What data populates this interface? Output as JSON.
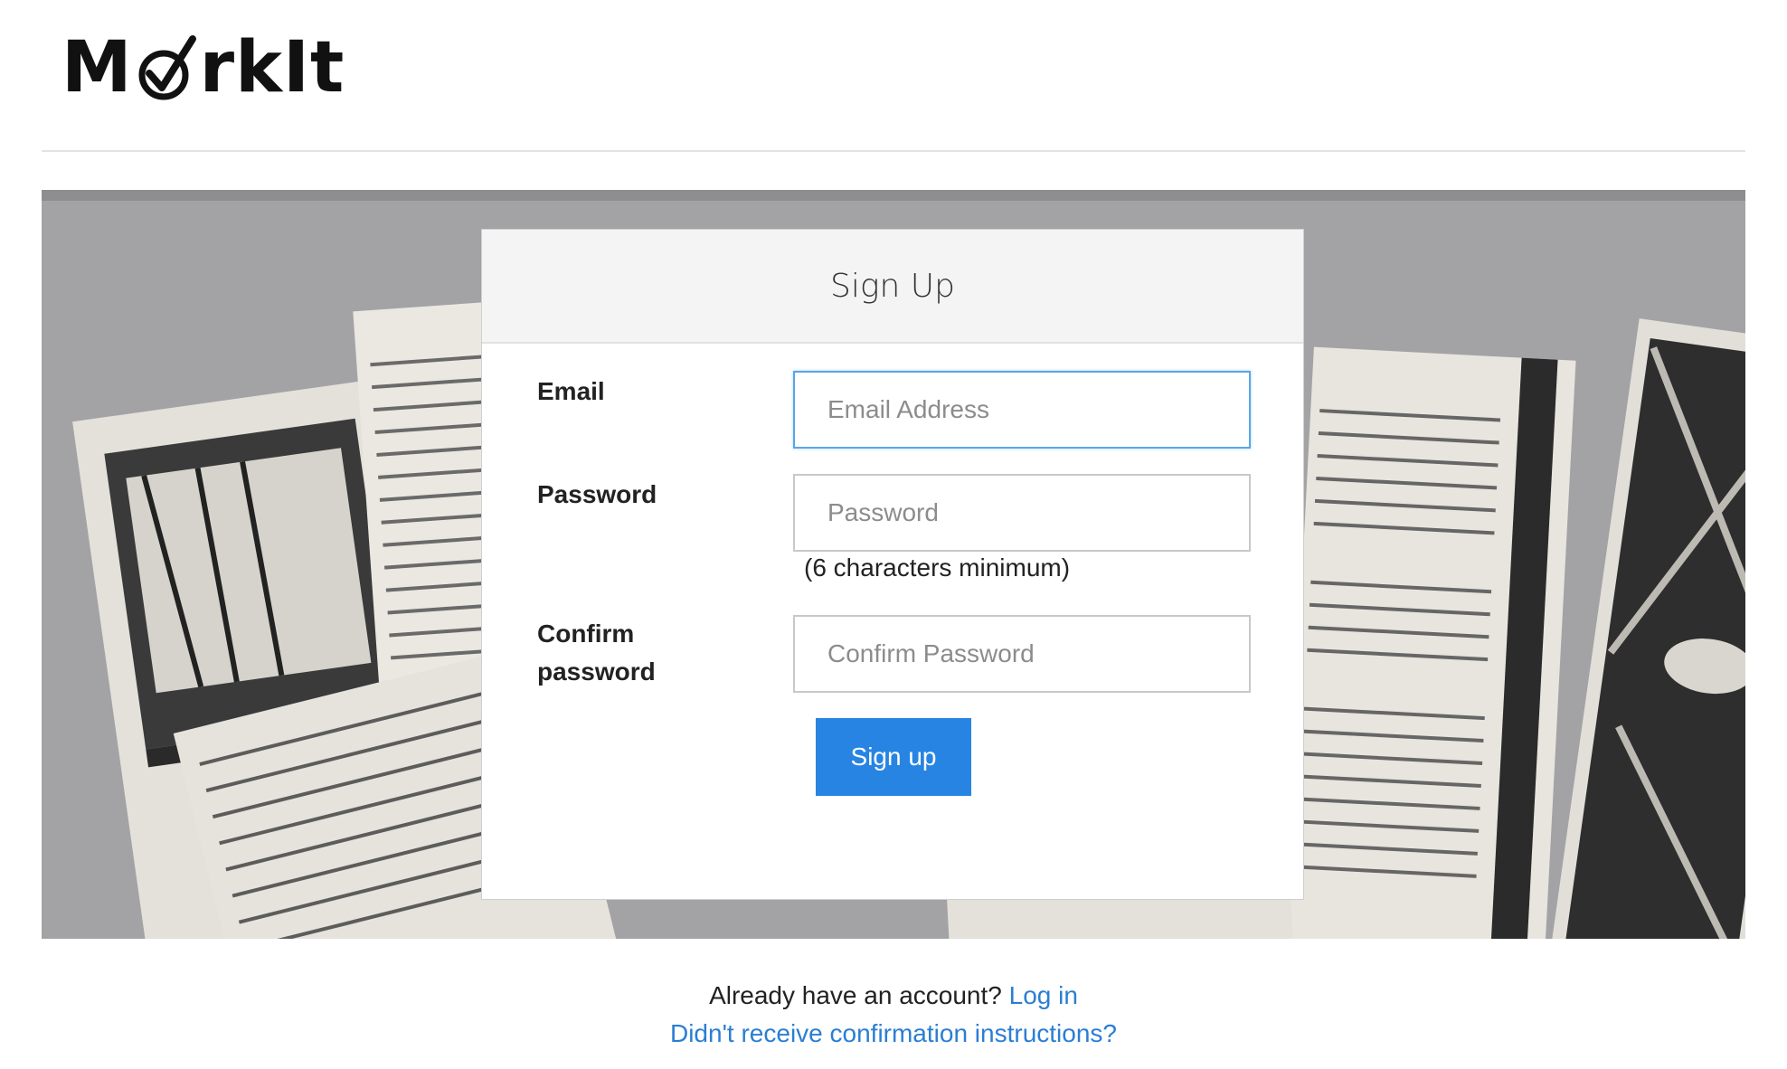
{
  "brand": {
    "logo_text_before": "M",
    "logo_text_after": "rkIt",
    "logo_icon": "check-circle-icon"
  },
  "hero": {
    "image": "open-illustrated-book-pages-photo"
  },
  "signup": {
    "title": "Sign Up",
    "email_label": "Email",
    "email_placeholder": "Email Address",
    "password_label": "Password",
    "password_placeholder": "Password",
    "password_hint": "(6 characters minimum)",
    "confirm_label_line1": "Confirm",
    "confirm_label_line2": "password",
    "confirm_placeholder": "Confirm Password",
    "submit_label": "Sign up"
  },
  "footer": {
    "account_prompt": "Already have an account?",
    "login_link": "Log in",
    "confirmation_link": "Didn't receive confirmation instructions?"
  },
  "colors": {
    "primary_button": "#2784e2",
    "link": "#2a7ed3",
    "focus_border": "#59a5e8",
    "hero_background": "#9a9a9c"
  }
}
